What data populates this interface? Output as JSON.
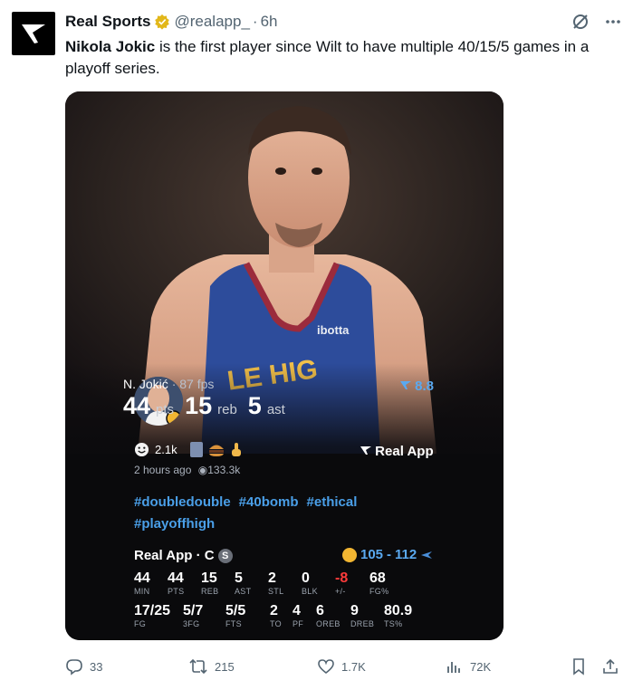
{
  "header": {
    "name": "Real Sports",
    "handle": "@realapp_",
    "separator": "·",
    "time": "6h"
  },
  "tweet": {
    "bold": "Nikola Jokic",
    "text": " is the first player since Wilt to have multiple 40/15/5 games in a playoff series."
  },
  "card": {
    "player_name": "N. Jokić",
    "fps": "· 87 fps",
    "pts": "44",
    "pts_unit": "pts",
    "reb": "15",
    "reb_unit": "reb",
    "ast": "5",
    "ast_unit": "ast",
    "score": "8.8",
    "reaction_count": "2.1k",
    "time_ago": "2 hours ago",
    "views": "133.3k",
    "brand": "Real App",
    "hashtags": [
      "#doubledouble",
      "#40bomb",
      "#ethical",
      "#playoffhigh"
    ],
    "box_title": "Real App · C",
    "box_badge": "S",
    "game_score_a": "105",
    "game_score_dash": "-",
    "game_score_b": "112",
    "row1": [
      {
        "v": "44",
        "l": "MIN"
      },
      {
        "v": "44",
        "l": "PTS"
      },
      {
        "v": "15",
        "l": "REB"
      },
      {
        "v": "5",
        "l": "AST"
      },
      {
        "v": "2",
        "l": "STL"
      },
      {
        "v": "0",
        "l": "BLK"
      },
      {
        "v": "-8",
        "l": "+/-"
      },
      {
        "v": "68",
        "l": "FG%"
      }
    ],
    "row2": [
      {
        "v": "17/25",
        "l": "FG"
      },
      {
        "v": "5/7",
        "l": "3FG"
      },
      {
        "v": "5/5",
        "l": "FTS"
      },
      {
        "v": "2",
        "l": "TO"
      },
      {
        "v": "4",
        "l": "PF"
      },
      {
        "v": "6",
        "l": "OREB"
      },
      {
        "v": "9",
        "l": "DREB"
      },
      {
        "v": "80.9",
        "l": "TS%"
      }
    ]
  },
  "actions": {
    "replies": "33",
    "retweets": "215",
    "likes": "1.7K",
    "views": "72K"
  },
  "colors": {
    "link_blue": "#4a9fe8",
    "negative": "#ff3b3b",
    "muted": "#536471"
  },
  "icons": [
    "reply-icon",
    "retweet-icon",
    "like-icon",
    "views-icon",
    "bookmark-icon",
    "share-icon",
    "grok-icon",
    "more-icon",
    "verified-icon"
  ]
}
